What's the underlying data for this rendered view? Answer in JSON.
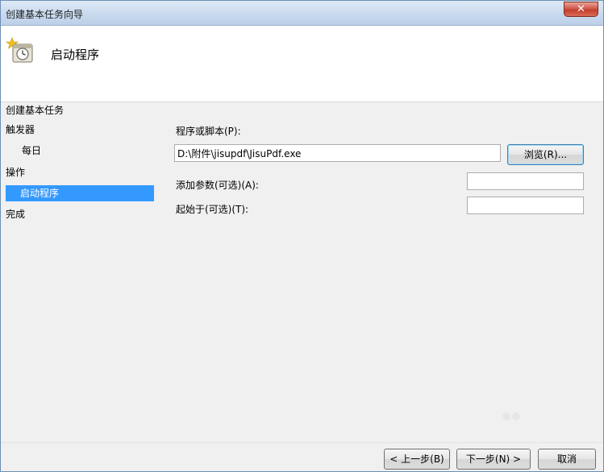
{
  "window": {
    "title": "创建基本任务向导",
    "close_label": "✕"
  },
  "header": {
    "title": "启动程序",
    "icon": "task-clock-icon"
  },
  "nav": {
    "items": [
      {
        "label": "创建基本任务",
        "selected": false
      },
      {
        "label": "触发器",
        "selected": false
      },
      {
        "label": "每日",
        "selected": false
      },
      {
        "label": "操作",
        "selected": false
      },
      {
        "label": "启动程序",
        "selected": true
      },
      {
        "label": "完成",
        "selected": false
      }
    ]
  },
  "form": {
    "program_label": "程序或脚本(P):",
    "program_value": "D:\\附件\\jisupdf\\JisuPdf.exe",
    "browse_label": "浏览(R)...",
    "args_label": "添加参数(可选)(A):",
    "args_value": "",
    "start_in_label": "起始于(可选)(T):",
    "start_in_value": ""
  },
  "footer": {
    "back_label": "< 上一步(B)",
    "next_label": "下一步(N) >",
    "cancel_label": "取消"
  },
  "colors": {
    "selection": "#3399ff",
    "title_bar": "#c9daee",
    "close_button": "#c33f2f"
  }
}
